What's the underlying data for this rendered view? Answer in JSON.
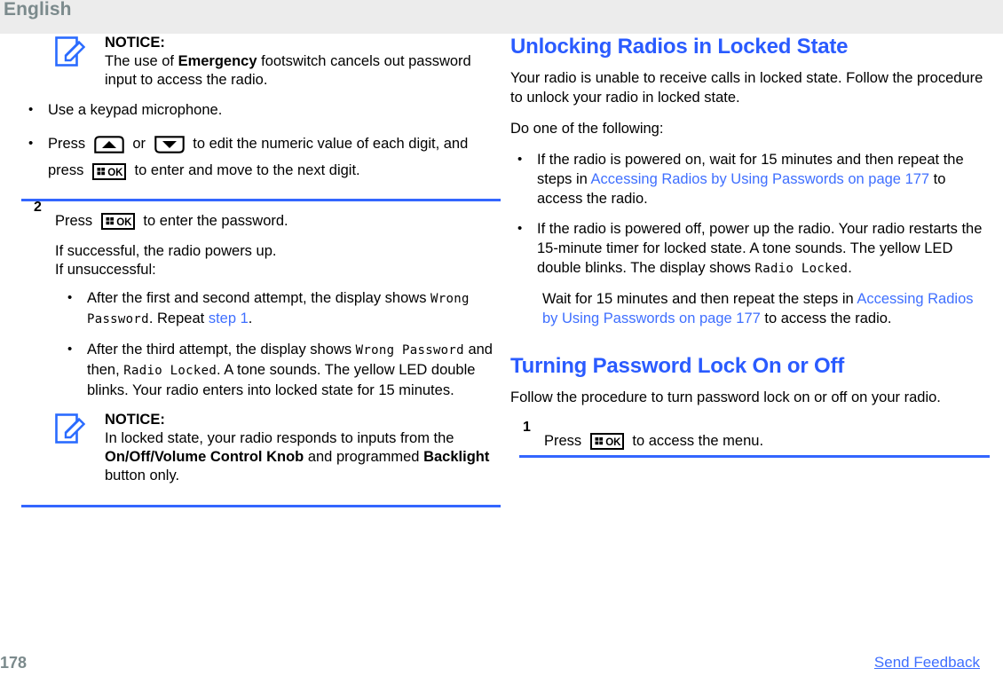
{
  "header": {
    "language": "English"
  },
  "left_column": {
    "notice_top": {
      "icon": "notice-pencil-icon",
      "label": "NOTICE:",
      "text_a": "The use of ",
      "text_bold": "Emergency",
      "text_b": " footswitch cancels out password input to access the radio."
    },
    "bullets": [
      {
        "text": "Use a keypad microphone."
      }
    ],
    "press_bullet": {
      "press": "Press",
      "or": "or",
      "mid": "to edit the numeric value of each digit, and press",
      "tail": "to enter and move to the next digit.",
      "icon_up": "arrow-up-key-icon",
      "icon_down": "arrow-down-key-icon",
      "icon_ok": "menu-ok-key-icon"
    },
    "step2": {
      "number": "2",
      "lead_a": "Press",
      "lead_b": "to enter the password.",
      "icon_ok": "menu-ok-key-icon",
      "result_line1": "If successful, the radio powers up.",
      "result_line2": "If unsuccessful:",
      "bullets": [
        {
          "a": "After the first and second attempt, the display shows ",
          "mono": "Wrong Password",
          "b": ". Repeat ",
          "link": "step 1",
          "c": "."
        },
        {
          "a": "After the third attempt, the display shows ",
          "mono1": "Wrong Password",
          "b": " and then, ",
          "mono2": "Radio Locked",
          "c": ". A tone sounds. The yellow LED double blinks. Your radio enters into locked state for 15 minutes."
        }
      ]
    },
    "notice_bottom": {
      "icon": "notice-pencil-icon",
      "label": "NOTICE:",
      "text_a": "In locked state, your radio responds to inputs from the ",
      "text_bold1": "On/Off/Volume Control Knob",
      "text_b": " and programmed ",
      "text_bold2": "Backlight",
      "text_c": " button only."
    }
  },
  "right_column": {
    "section1": {
      "title": "Unlocking Radios in Locked State",
      "intro": "Your radio is unable to receive calls in locked state. Follow the procedure to unlock your radio in locked state.",
      "lead": "Do one of the following:",
      "bullets": [
        {
          "a": "If the radio is powered on, wait for 15 minutes and then repeat the steps in ",
          "link": "Accessing Radios by Using Passwords on page 177",
          "b": " to access the radio."
        },
        {
          "a": "If the radio is powered off, power up the radio. Your radio restarts the 15-minute timer for locked state. A tone sounds. The yellow LED double blinks. The display shows ",
          "mono": "Radio Locked",
          "b": "."
        }
      ],
      "wait_para": {
        "a": "Wait for 15 minutes and then repeat the steps in ",
        "link": "Accessing Radios by Using Passwords on page 177",
        "b": " to access the radio."
      }
    },
    "section2": {
      "title": "Turning Password Lock On or Off",
      "intro": "Follow the procedure to turn password lock on or off on your radio.",
      "step1": {
        "number": "1",
        "lead_a": "Press",
        "lead_b": "to access the menu.",
        "icon_ok": "menu-ok-key-icon"
      }
    }
  },
  "footer": {
    "page_number": "178",
    "feedback_label": "Send Feedback"
  },
  "colors": {
    "heading_blue": "#2a5bff",
    "link_blue": "#3f6fff",
    "rule_blue": "#3366ff",
    "header_gray": "#7b8a8c",
    "header_band": "#ececec"
  }
}
